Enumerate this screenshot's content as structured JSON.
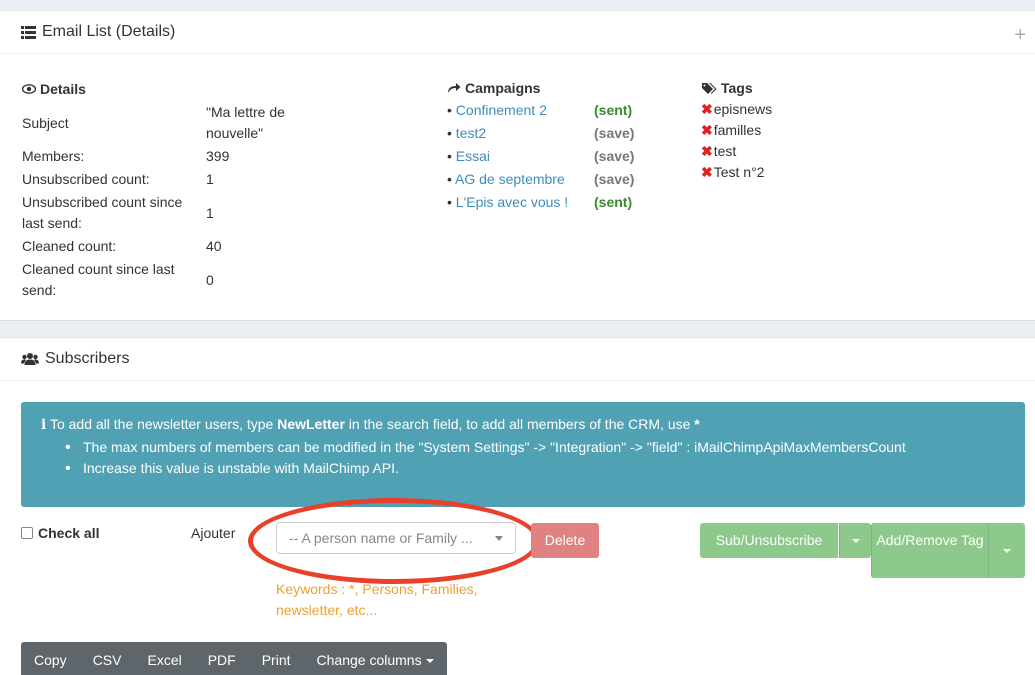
{
  "email_list": {
    "title": "Email List (Details)",
    "plus": "+"
  },
  "details": {
    "heading": "Details",
    "rows": [
      {
        "label": "Subject",
        "value": "\"Ma lettre de nouvelle\""
      },
      {
        "label": "Members:",
        "value": "399"
      },
      {
        "label": "Unsubscribed count:",
        "value": "1"
      },
      {
        "label": "Unsubscribed count since last send:",
        "value": "1"
      },
      {
        "label": "Cleaned count:",
        "value": "40"
      },
      {
        "label": "Cleaned count since last send:",
        "value": "0"
      }
    ]
  },
  "campaigns": {
    "heading": "Campaigns",
    "items": [
      {
        "name": "Confinement 2",
        "status": "(sent)"
      },
      {
        "name": "test2",
        "status": "(save)"
      },
      {
        "name": "Essai",
        "status": "(save)"
      },
      {
        "name": "AG de septembre",
        "status": "(save)"
      },
      {
        "name": "L'Epis avec vous !",
        "status": "(sent)"
      }
    ]
  },
  "tags": {
    "heading": "Tags",
    "items": [
      "episnews",
      "familles",
      "test",
      "Test n°2"
    ]
  },
  "subscribers": {
    "title": "Subscribers",
    "info_pre": "To add all the newsletter users, type ",
    "info_bold": "NewLetter",
    "info_post": " in the search field, to add all members of the CRM, use ",
    "info_star": "*",
    "bullets": [
      "The max numbers of members can be modified in the \"System Settings\" -> \"Integration\" -> \"field\" : iMailChimpApiMaxMembersCount",
      "Increase this value is unstable with MailChimp API."
    ],
    "check_all": "Check all",
    "ajouter": "Ajouter",
    "search_placeholder": "-- A person name or Family ...",
    "delete": "Delete",
    "sub_unsub": "Sub/Unsubscribe",
    "add_remove_tag": "Add/Remove Tag",
    "keywords": "Keywords : *, Persons, Families, newsletter, etc...",
    "export_buttons": [
      "Copy",
      "CSV",
      "Excel",
      "PDF",
      "Print"
    ],
    "change_columns": "Change columns"
  }
}
